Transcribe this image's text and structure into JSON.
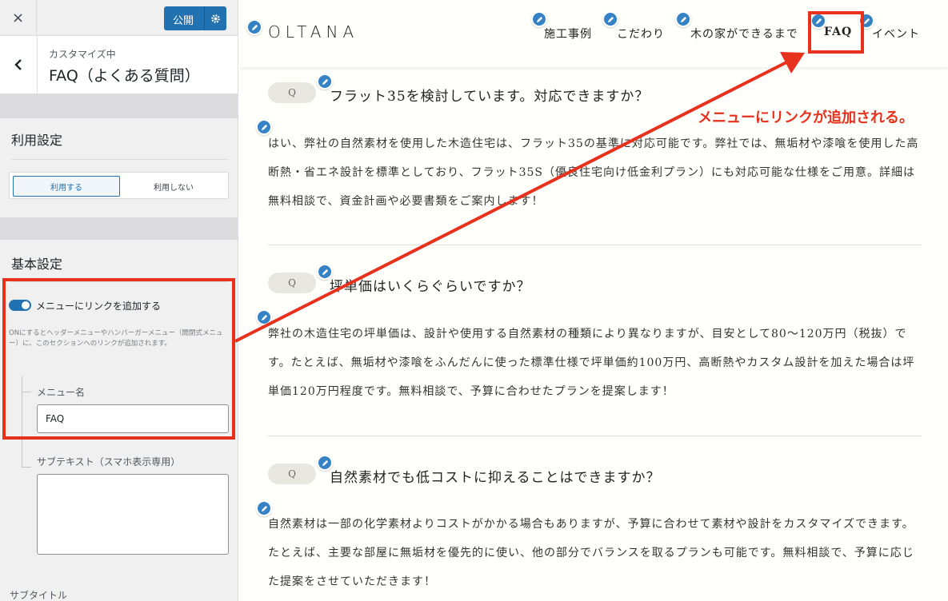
{
  "sidebar": {
    "close_icon": "×",
    "publish_label": "公開",
    "crumb": "カスタマイズ中",
    "section_title": "FAQ（よくある質問）",
    "usage": {
      "title": "利用設定",
      "on_label": "利用する",
      "off_label": "利用しない"
    },
    "basic": {
      "title": "基本設定",
      "toggle_label": "メニューにリンクを追加する",
      "toggle_on": true,
      "help": "ONにするとヘッダーメニューやハンバーガーメニュー（開閉式メニュー）に、このセクションへのリンクが追加されます。",
      "menu_name_label": "メニュー名",
      "menu_name_value": "FAQ",
      "subtext_label": "サブテキスト（スマホ表示専用）",
      "subtitle_label": "サブタイトル"
    }
  },
  "preview": {
    "logo": "OLTANA",
    "nav": [
      "施工事例",
      "こだわり",
      "木の家ができるまで",
      "FAQ",
      "イベント"
    ],
    "q_label": "Q",
    "faqs": [
      {
        "question": "フラット35を検討しています。対応できますか？",
        "answer": "はい、弊社の自然素材を使用した木造住宅は、フラット35の基準に対応可能です。弊社では、無垢材や漆喰を使用した高断熱・省エネ設計を標準としており、フラット35S（優良住宅向け低金利プラン）にも対応可能な仕様をご用意。詳細は無料相談で、資金計画や必要書類をご案内します！"
      },
      {
        "question": "坪単価はいくらぐらいですか？",
        "answer": "弊社の木造住宅の坪単価は、設計や使用する自然素材の種類により異なりますが、目安として80〜120万円（税抜）です。たとえば、無垢材や漆喰をふんだんに使った標準仕様で坪単価約100万円、高断熱やカスタム設計を加えた場合は坪単価120万円程度です。無料相談で、予算に合わせたプランを提案します！"
      },
      {
        "question": "自然素材でも低コストに抑えることはできますか？",
        "answer": "自然素材は一部の化学素材よりコストがかかる場合もありますが、予算に合わせて素材や設計をカスタマイズできます。たとえば、主要な部屋に無垢材を優先的に使い、他の部分でバランスを取るプランも可能です。無料相談で、予算に応じた提案をさせていただきます！"
      }
    ],
    "annotation": "メニューにリンクが追加される。"
  },
  "colors": {
    "accent": "#2271b1",
    "annotation_red": "#e8311d",
    "preview_bg": "#fffffb"
  }
}
